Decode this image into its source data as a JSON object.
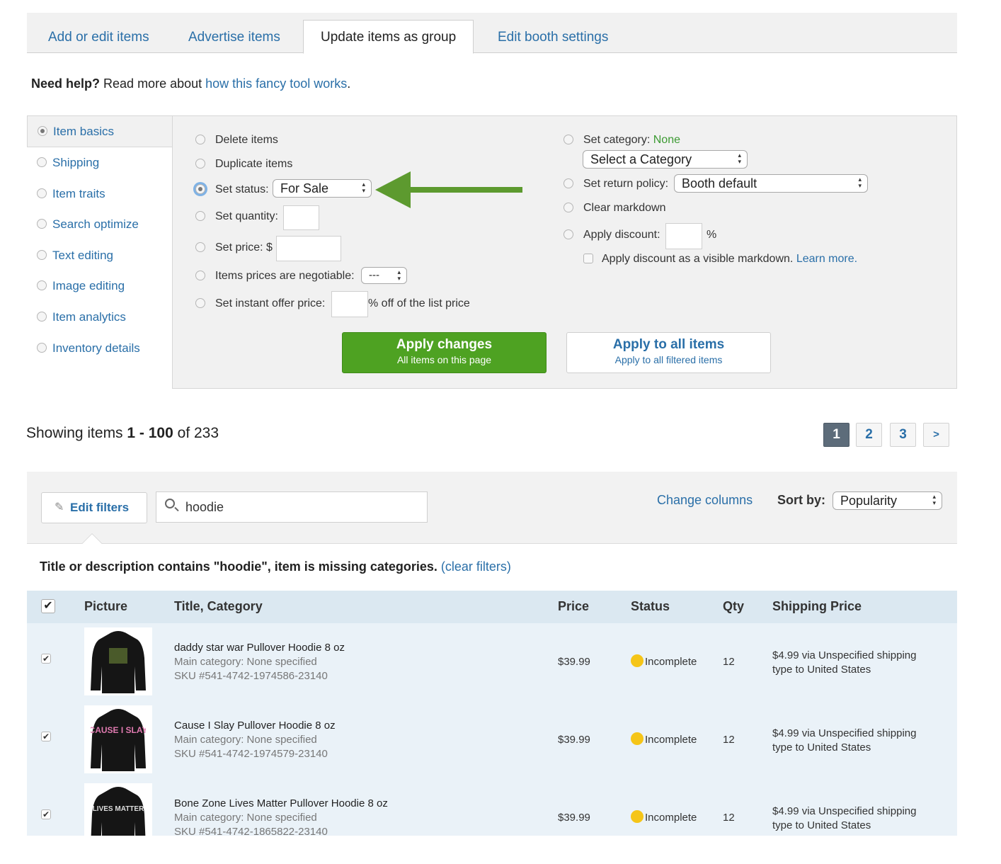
{
  "tabs": [
    "Add or edit items",
    "Advertise items",
    "Update items as group",
    "Edit booth settings"
  ],
  "help": {
    "bold": "Need help?",
    "text": "Read more about",
    "link": "how this fancy tool works",
    "end": "."
  },
  "side": [
    "Item basics",
    "Shipping",
    "Item traits",
    "Search optimize",
    "Text editing",
    "Image editing",
    "Item analytics",
    "Inventory details"
  ],
  "panel": {
    "delete": "Delete items",
    "duplicate": "Duplicate items",
    "set_status": "Set status:",
    "status_value": "For Sale",
    "set_quantity": "Set quantity:",
    "set_price": "Set price: $",
    "negotiable": "Items prices are negotiable:",
    "negotiable_value": "---",
    "instant_offer": "Set instant offer price:",
    "instant_offer_suffix": "% off of the list price",
    "set_category": "Set category:",
    "category_current": "None",
    "category_select": "Select a Category",
    "return_policy": "Set return policy:",
    "return_value": "Booth default",
    "clear_markdown": "Clear markdown",
    "apply_discount": "Apply discount:",
    "percent": "%",
    "visible_markdown": "Apply discount as a visible markdown.",
    "learn_more": "Learn more.",
    "apply_changes": "Apply changes",
    "apply_changes_sub": "All items on this page",
    "apply_all": "Apply to all items",
    "apply_all_sub": "Apply to all filtered items"
  },
  "showing": {
    "prefix": "Showing items",
    "range": "1 - 100",
    "of": "of",
    "total": "233"
  },
  "pager": [
    "1",
    "2",
    "3",
    ">"
  ],
  "filters": {
    "edit_filters": "Edit filters",
    "search_value": "hoodie",
    "change_columns": "Change columns",
    "sort_label": "Sort by:",
    "sort_value": "Popularity",
    "summary": "Title or description contains \"hoodie\", item is missing categories.",
    "clear": "(clear filters)"
  },
  "table": {
    "headers": [
      "Picture",
      "Title, Category",
      "Price",
      "Status",
      "Qty",
      "Shipping Price"
    ],
    "rows": [
      {
        "title": "daddy star war Pullover Hoodie 8 oz",
        "category": "Main category: None specified",
        "sku": "SKU #541-4742-1974586-23140",
        "price": "$39.99",
        "status": "Incomplete",
        "qty": "12",
        "ship1": "$4.99 via Unspecified shipping",
        "ship2": "type to United States",
        "print": ""
      },
      {
        "title": "Cause I Slay Pullover Hoodie 8 oz",
        "category": "Main category: None specified",
        "sku": "SKU #541-4742-1974579-23140",
        "price": "$39.99",
        "status": "Incomplete",
        "qty": "12",
        "ship1": "$4.99 via Unspecified shipping",
        "ship2": "type to United States",
        "print": "CAUSE I SLAY"
      },
      {
        "title": "Bone Zone Lives Matter Pullover Hoodie 8 oz",
        "category": "Main category: None specified",
        "sku": "SKU #541-4742-1865822-23140",
        "price": "$39.99",
        "status": "Incomplete",
        "qty": "12",
        "ship1": "$4.99 via Unspecified shipping",
        "ship2": "type to United States",
        "print": "LIVES MATTER"
      }
    ]
  },
  "colors": {
    "link": "#2a6fa8",
    "green": "#4ea222",
    "arrow": "#5d9a2f",
    "status": "#f5c518"
  }
}
